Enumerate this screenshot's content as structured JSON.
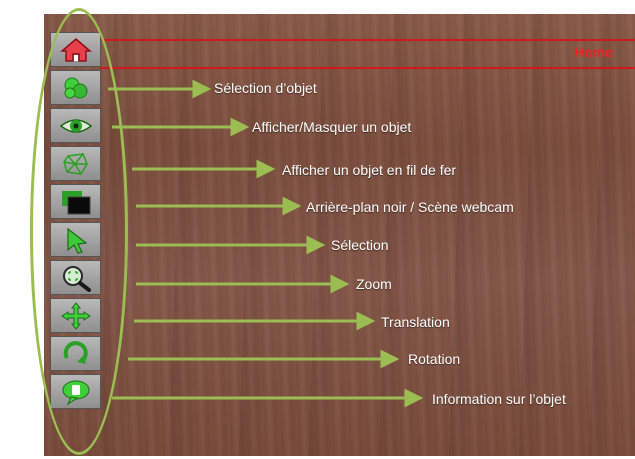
{
  "header": {
    "home_label": "Home"
  },
  "tools": [
    {
      "icon": "home-icon",
      "label": ""
    },
    {
      "icon": "object-selection-icon",
      "label": "Sélection d’objet"
    },
    {
      "icon": "eye-icon",
      "label": "Afficher/Masquer un objet"
    },
    {
      "icon": "wireframe-icon",
      "label": "Afficher un objet en fil de fer"
    },
    {
      "icon": "background-icon",
      "label": "Arrière-plan noir / Scène webcam"
    },
    {
      "icon": "cursor-arrow-icon",
      "label": "Sélection"
    },
    {
      "icon": "zoom-icon",
      "label": "Zoom"
    },
    {
      "icon": "move-arrows-icon",
      "label": "Translation"
    },
    {
      "icon": "rotation-icon",
      "label": "Rotation"
    },
    {
      "icon": "info-bubble-icon",
      "label": "Information sur l’objet"
    }
  ],
  "colors": {
    "arrow": "#9bbd52",
    "header_line": "#d0181e",
    "home_text": "#ee2222"
  }
}
